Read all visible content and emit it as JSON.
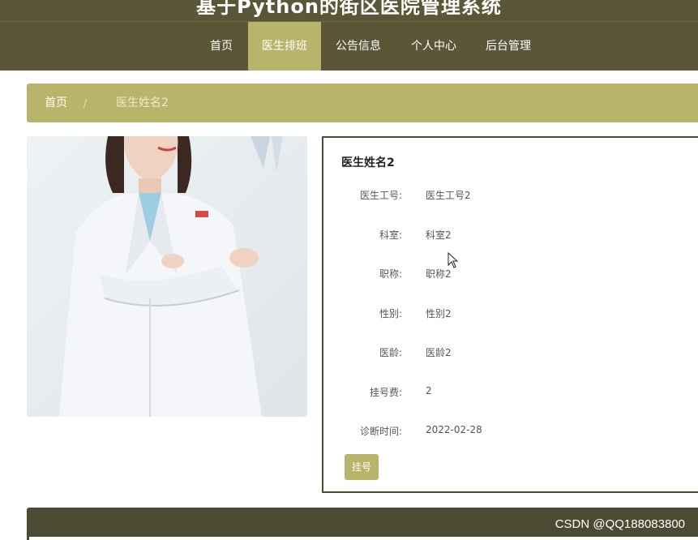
{
  "header": {
    "title": "基于Python的街区医院管理系统"
  },
  "nav": {
    "items": [
      {
        "label": "首页"
      },
      {
        "label": "医生排班"
      },
      {
        "label": "公告信息"
      },
      {
        "label": "个人中心"
      },
      {
        "label": "后台管理"
      }
    ],
    "active": "医生排班"
  },
  "breadcrumb": {
    "home": "首页",
    "separator": "/",
    "current": "医生姓名2"
  },
  "doctor": {
    "name": "医生姓名2",
    "fields": [
      {
        "label": "医生工号:",
        "value": "医生工号2"
      },
      {
        "label": "科室:",
        "value": "科室2"
      },
      {
        "label": "职称:",
        "value": "职称2"
      },
      {
        "label": "性别:",
        "value": "性别2"
      },
      {
        "label": "医龄:",
        "value": "医龄2"
      },
      {
        "label": "挂号费:",
        "value": "2"
      },
      {
        "label": "诊断时间:",
        "value": "2022-02-28"
      }
    ],
    "action_label": "挂号"
  },
  "watermark": "CSDN @QQ188083800",
  "colors": {
    "nav_bg": "#5b5638",
    "accent": "#b8b46a",
    "border": "#4d4a33"
  }
}
